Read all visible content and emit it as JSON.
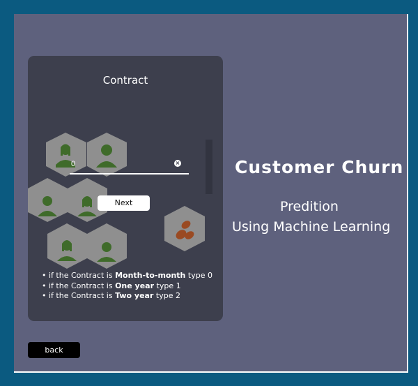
{
  "card": {
    "title": "Contract",
    "input": {
      "value": "0",
      "clear_icon": "close-icon"
    },
    "next_label": "Next",
    "notes": [
      {
        "prefix": "if the Contract is ",
        "strong": "Month-to-month",
        "suffix": " type 0"
      },
      {
        "prefix": "if the Contract is ",
        "strong": "One year",
        "suffix": " type 1"
      },
      {
        "prefix": "if the Contract is ",
        "strong": "Two year",
        "suffix": " type 2"
      }
    ]
  },
  "brand": {
    "title": "Customer Churn",
    "subtitle_line1": "Predition",
    "subtitle_line2": "Using Machine Learning"
  },
  "back_label": "back",
  "colors": {
    "page_border": "#0b5a80",
    "stage": "#5e617d",
    "card": "#3d3f4d",
    "hex_fill": "#8f8f8f",
    "person_icon": "#3f6b2a",
    "coin_icon": "#9a4a22"
  },
  "icons": [
    "person-icon",
    "coins-icon",
    "close-icon"
  ]
}
